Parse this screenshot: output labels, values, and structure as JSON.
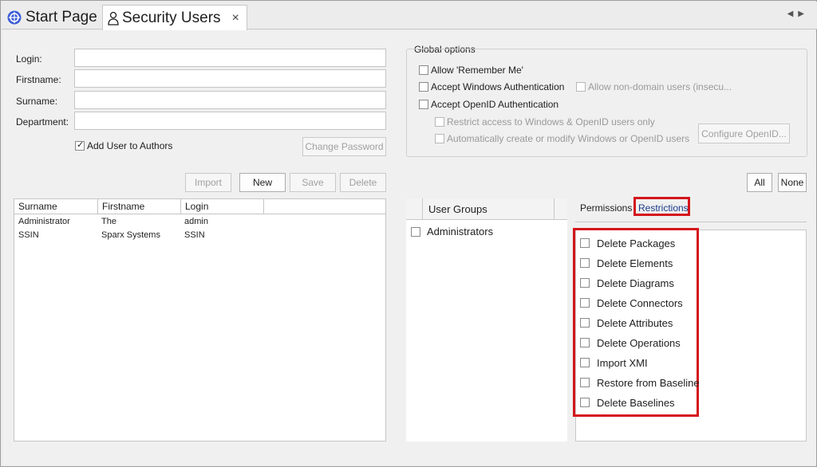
{
  "tabs": {
    "start_page": "Start Page",
    "security_users": "Security Users",
    "close_glyph": "×"
  },
  "form": {
    "login_label": "Login:",
    "firstname_label": "Firstname:",
    "surname_label": "Surname:",
    "department_label": "Department:",
    "login_value": "",
    "firstname_value": "",
    "surname_value": "",
    "department_value": "",
    "add_to_authors_label": "Add User to Authors",
    "add_to_authors_checked": true,
    "change_password": "Change Password"
  },
  "actions": {
    "import": "Import",
    "new": "New",
    "save": "Save",
    "delete": "Delete"
  },
  "global_options": {
    "title": "Global options",
    "allow_remember_me": "Allow 'Remember Me'",
    "accept_windows_auth": "Accept Windows Authentication",
    "allow_non_domain": "Allow non-domain users (insecu...",
    "accept_openid": "Accept OpenID Authentication",
    "restrict_access": "Restrict access to Windows & OpenID users only",
    "auto_create": "Automatically create or modify Windows or OpenID users",
    "configure_openid": "Configure OpenID..."
  },
  "select_buttons": {
    "all": "All",
    "none": "None"
  },
  "users_table": {
    "columns": [
      "Surname",
      "Firstname",
      "Login"
    ],
    "rows": [
      [
        "Administrator",
        "The",
        "admin"
      ],
      [
        "SSIN",
        "Sparx Systems",
        "SSIN"
      ]
    ]
  },
  "user_groups": {
    "header": "User Groups",
    "items": [
      "Administrators"
    ]
  },
  "perm_tabs": {
    "permissions": "Permissions",
    "restrictions": "Restrictions"
  },
  "restrictions": [
    "Delete Packages",
    "Delete Elements",
    "Delete Diagrams",
    "Delete Connectors",
    "Delete Attributes",
    "Delete Operations",
    "Import XMI",
    "Restore from Baseline",
    "Delete Baselines"
  ],
  "colors": {
    "highlight_red": "#d4151c",
    "tab_active_bg": "#ffffff",
    "panel_bg": "#f0f0f0"
  }
}
